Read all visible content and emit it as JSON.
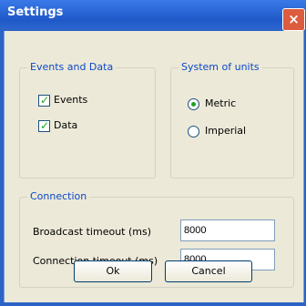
{
  "dialog": {
    "title": "Settings",
    "close_label": "×"
  },
  "events_and_data": {
    "legend": "Events and Data",
    "events_label": "Events",
    "events_checked": true,
    "data_label": "Data",
    "data_checked": true
  },
  "system_of_units": {
    "legend": "System of units",
    "metric_label": "Metric",
    "imperial_label": "Imperial",
    "selected": "Metric"
  },
  "connection": {
    "legend": "Connection",
    "broadcast_timeout_label": "Broadcast timeout (ms)",
    "broadcast_timeout_value": "8000",
    "connection_timeout_label": "Connection timeout (ms)",
    "connection_timeout_value": "8000"
  },
  "buttons": {
    "ok_label": "Ok",
    "cancel_label": "Cancel"
  }
}
